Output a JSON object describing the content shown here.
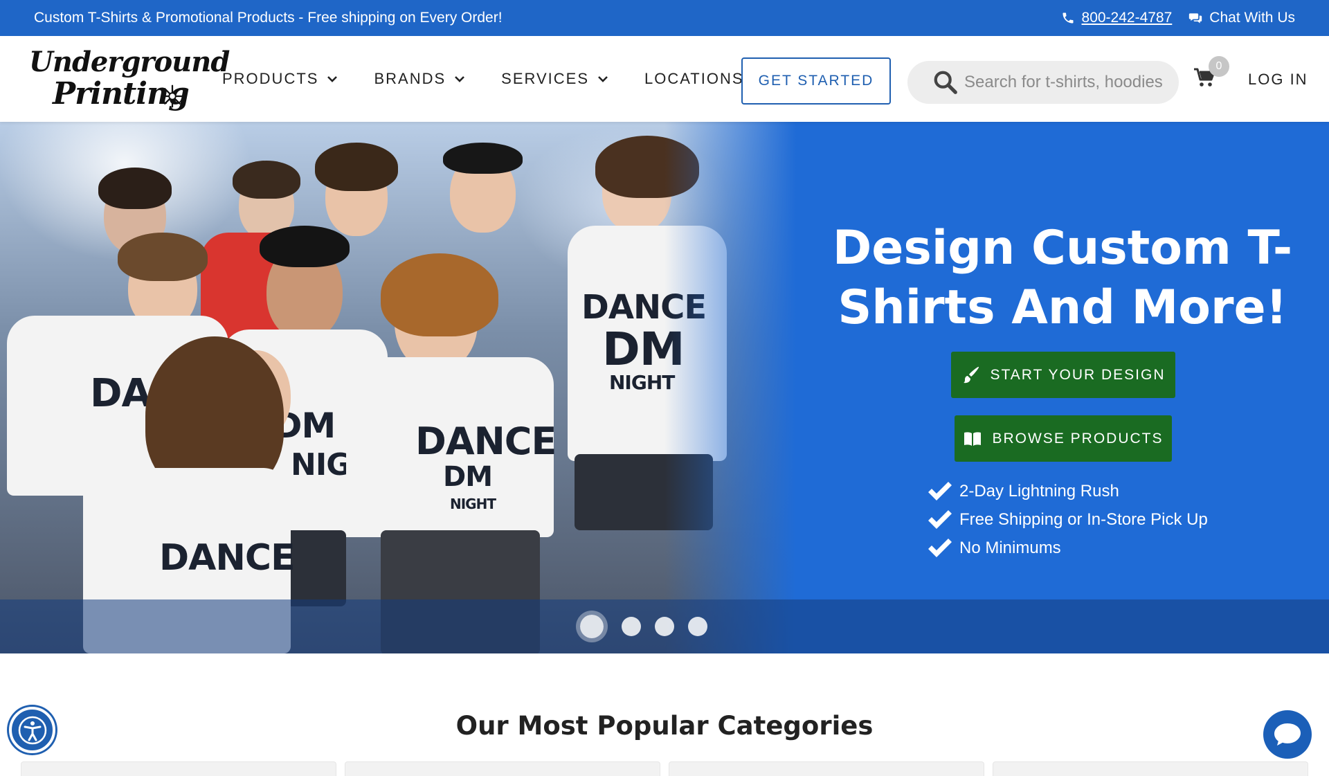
{
  "topbar": {
    "promo": "Custom T-Shirts & Promotional Products - Free shipping on Every Order!",
    "phone": "800-242-4787",
    "chat": "Chat With Us"
  },
  "logo": {
    "line1": "Underground",
    "line2": "Printing"
  },
  "nav": {
    "items": [
      {
        "label": "PRODUCTS"
      },
      {
        "label": "BRANDS"
      },
      {
        "label": "SERVICES"
      },
      {
        "label": "LOCATIONS"
      }
    ],
    "cta": "GET STARTED",
    "search_placeholder": "Search for t-shirts, hoodies",
    "cart_count": "0",
    "login": "LOG IN"
  },
  "hero": {
    "title": "Design Custom T-Shirts And More!",
    "start_design": "START YOUR DESIGN",
    "browse_products": "BROWSE PRODUCTS",
    "features": [
      {
        "text": "2-Day Lightning Rush"
      },
      {
        "text": "Free Shipping or In-Store Pick Up"
      },
      {
        "text": "No Minimums"
      }
    ],
    "slides": {
      "count": 4,
      "active": 1
    },
    "photo_shirt_text": [
      "DANCE",
      "DM",
      "NIGHT",
      "DANCE",
      "DM",
      "NIGHT",
      "DANCE",
      "DM",
      "NIGHT",
      "DANCE"
    ]
  },
  "sections": {
    "popular_title": "Our Most Popular Categories"
  },
  "colors": {
    "topbar_blue": "#1f66c7",
    "hero_blue": "#1f6bd6",
    "cta_green": "#1a6b22",
    "nav_outline_blue": "#1f5fb0"
  },
  "icons": [
    "phone-icon",
    "chat-icon",
    "chevron-down-icon",
    "search-icon",
    "cart-icon",
    "paintbrush-icon",
    "book-icon",
    "checkmark-icon",
    "accessibility-icon",
    "chat-bubble-icon"
  ]
}
